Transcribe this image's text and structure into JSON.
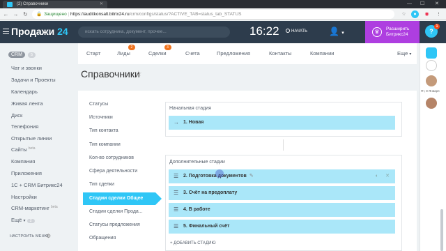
{
  "browser": {
    "tab_title": "(2) Справочники",
    "secure_label": "Защищено",
    "url_host": "https://auditkonsalt.bitrix24.ru",
    "url_path": "/crm/configs/status/?ACTIVE_TAB=status_tab_STATUS"
  },
  "header": {
    "logo_text": "Продажи",
    "logo_num": "24",
    "search_placeholder": "искать сотрудника, документ, прочее...",
    "clock": "16:22",
    "start_label": "НАЧАТЬ",
    "upgrade_line1": "Расширить",
    "upgrade_line2": "Битрикс24",
    "help_badge": "1"
  },
  "sidebar": {
    "crm_label": "CRM",
    "crm_count": "5",
    "items": [
      "Чат и звонки",
      "Задачи и Проекты",
      "Календарь",
      "Живая лента",
      "Диск",
      "Телефония",
      "Открытые линии",
      "Сайты",
      "Компания",
      "Приложения",
      "1С + CRM Битрикс24",
      "Настройки",
      "CRM-маркетинг",
      "Ещё"
    ],
    "beta": "beta",
    "more_count": "2",
    "settings_label": "НАСТРОИТЬ МЕНЮ"
  },
  "tabs": {
    "items": [
      "Старт",
      "Лиды",
      "Сделки",
      "Счета",
      "Предложения",
      "Контакты",
      "Компании"
    ],
    "leads_badge": "2",
    "deals_badge": "3",
    "more": "Еще"
  },
  "page": {
    "title": "Справочники"
  },
  "menu": {
    "items": [
      "Статусы",
      "Источники",
      "Тип контакта",
      "Тип компании",
      "Кол-во сотрудников",
      "Сфера деятельности",
      "Тип сделки",
      "Стадии сделки Общее",
      "Стадии сделки Прода...",
      "Статусы предложения",
      "Обращения"
    ]
  },
  "stages": {
    "initial_title": "Начальная стадия",
    "initial": "1. Новая",
    "extra_title": "Дополнительные стадии",
    "extra": [
      "2. Подготовка документов",
      "3. Счёт на предоплату",
      "4. В работе",
      "5. Финальный счёт"
    ],
    "add_label": "+ ДОБАВИТЬ СТАДИЮ"
  },
  "rail": {
    "label": "Пт, 8 Января"
  },
  "colors": {
    "header": "#2d3c4c",
    "accent": "#2fc6f6",
    "stage_fill": "#aae7f9",
    "upgrade": "#ae3ee0",
    "badge_orange": "#f0731e"
  }
}
